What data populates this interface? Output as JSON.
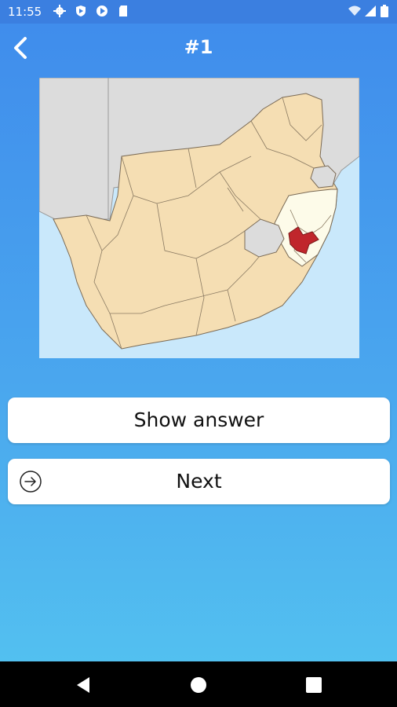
{
  "status_bar": {
    "time": "11:55",
    "left_icons": [
      "settings-icon",
      "shield-icon",
      "play-store-icon",
      "sd-card-icon"
    ],
    "right_icons": [
      "wifi-icon",
      "signal-icon",
      "battery-icon"
    ]
  },
  "header": {
    "title": "#1",
    "back_icon": "chevron-left-icon"
  },
  "map": {
    "icon": "south-africa-districts-map",
    "land_color": "#f5deb3",
    "highlight_province_color": "#fdfbe9",
    "selected_district_color": "#c0262c",
    "neighbor_color": "#dcdcdc",
    "sea_color": "#c9e8fb"
  },
  "buttons": {
    "show_answer": "Show answer",
    "next": "Next",
    "next_icon": "arrow-right-circle-icon"
  },
  "nav_bar": {
    "icons": [
      "back-triangle-icon",
      "home-circle-icon",
      "recents-square-icon"
    ]
  }
}
